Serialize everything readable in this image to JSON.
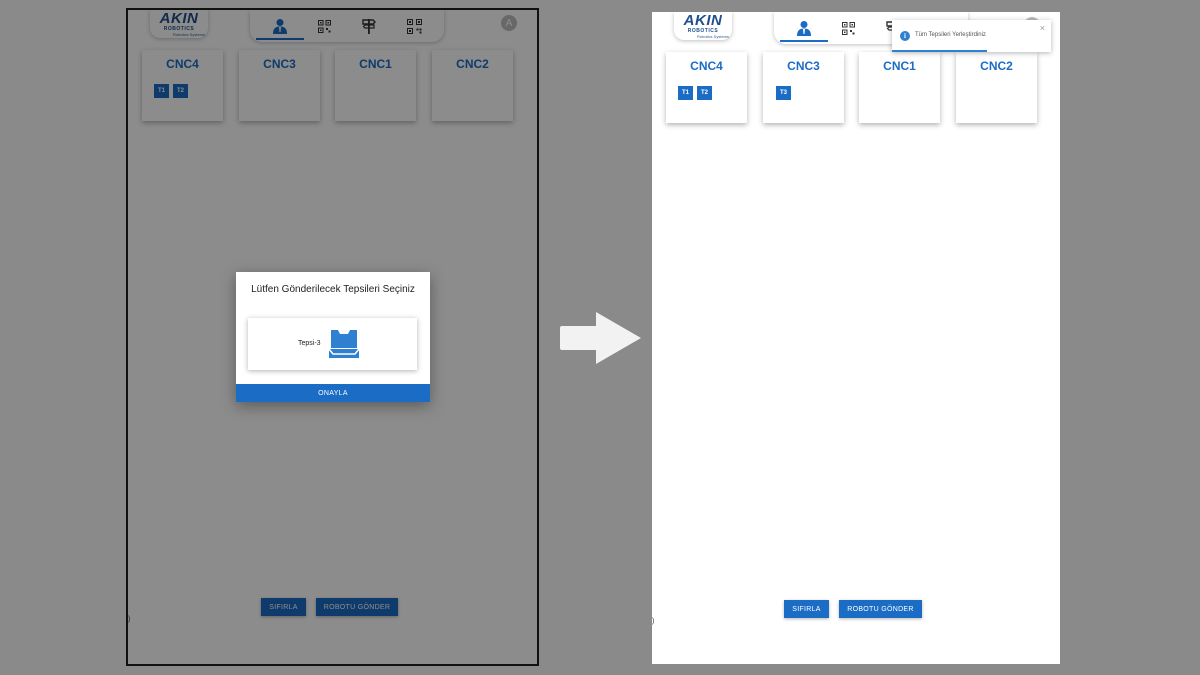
{
  "brand": {
    "main": "AKIN",
    "sub": "ROBOTICS",
    "tagline": "Robotics Systems"
  },
  "avatar_letter": "A",
  "nav_icons": [
    "user-icon",
    "qr-code-icon",
    "signpost-icon",
    "qr-scan-icon"
  ],
  "before": {
    "cards": [
      {
        "title": "CNC4",
        "trays": [
          "T1",
          "T2"
        ]
      },
      {
        "title": "CNC3",
        "trays": []
      },
      {
        "title": "CNC1",
        "trays": []
      },
      {
        "title": "CNC2",
        "trays": []
      }
    ],
    "modal": {
      "title": "Lütfen Gönderilecek Tepsileri Seçiniz",
      "option_label": "Tepsi-3",
      "confirm_label": "ONAYLA"
    }
  },
  "after": {
    "cards": [
      {
        "title": "CNC4",
        "trays": [
          "T1",
          "T2"
        ]
      },
      {
        "title": "CNC3",
        "trays": [
          "T3"
        ]
      },
      {
        "title": "CNC1",
        "trays": []
      },
      {
        "title": "CNC2",
        "trays": []
      }
    ],
    "toast": {
      "message": "Tüm Tepsileri Yerleştirdiniz",
      "close": "×",
      "progress": 0.6
    }
  },
  "buttons": {
    "reset": "SIFIRLA",
    "send": "ROBOTU GÖNDER"
  },
  "paren": ")",
  "colors": {
    "accent": "#1a6cc4",
    "dim_overlay": "rgba(0,0,0,0.45)",
    "backdrop": "#8a8a8a"
  }
}
